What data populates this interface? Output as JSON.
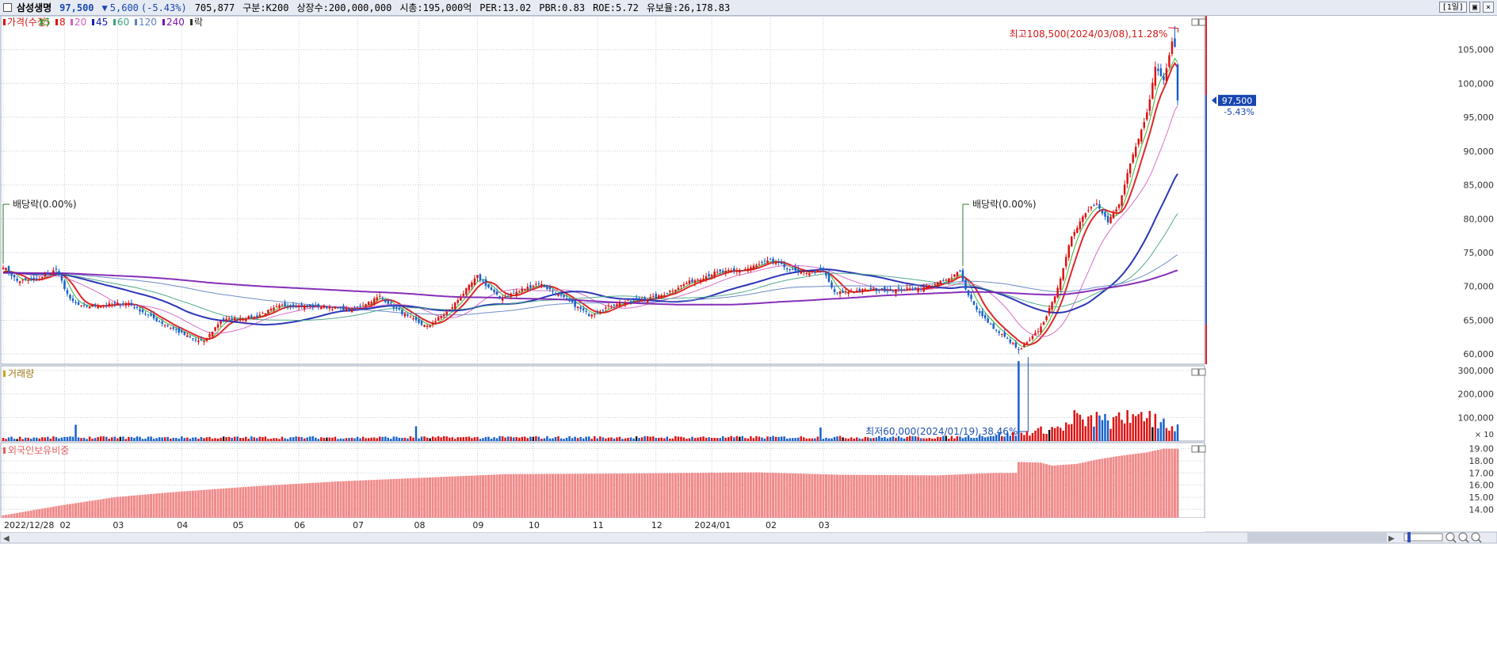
{
  "header": {
    "name": "삼성생명",
    "price": "97,500",
    "change_arrow": "▼",
    "change": "5,600",
    "change_pct": "(-5.43%)",
    "volume": "705,877",
    "market": "구분:K200",
    "shares": "상장수:200,000,000",
    "mktcap": "시총:195,000억",
    "per": "PER:13.02",
    "pbr": "PBR:0.83",
    "roe": "ROE:5.72",
    "float": "유보율:26,178.83",
    "period": "[1일]"
  },
  "legend": {
    "price_label": "가격(수정)",
    "ma": [
      {
        "label": "5",
        "color": "#22aa22"
      },
      {
        "label": "8",
        "color": "#dd1111"
      },
      {
        "label": "20",
        "color": "#d060c0"
      },
      {
        "label": "45",
        "color": "#1520b0"
      },
      {
        "label": "60",
        "color": "#40a080"
      },
      {
        "label": "120",
        "color": "#6080c0"
      },
      {
        "label": "240",
        "color": "#7a18b0"
      }
    ],
    "extra": "락",
    "volume_label": "거래량",
    "foreign_label": "외국인보유비중"
  },
  "annotations": {
    "high": "최고108,500(2024/03/08),11.28%",
    "low": "최저60,000(2024/01/19),38.46%",
    "div1": "배당락(0.00%)",
    "div2": "배당락(0.00%)",
    "current_price": "97,500",
    "current_pct": "-5.43%"
  },
  "colors": {
    "up": "#dd1111",
    "down": "#1560cc",
    "foreign_bar": "#f08a8a",
    "axis_text": "#333333"
  },
  "chart_data": {
    "type": "candlestick",
    "x_labels": [
      "2022/12/28",
      "02",
      "03",
      "04",
      "05",
      "06",
      "07",
      "08",
      "09",
      "10",
      "11",
      "12",
      "2024/01",
      "02",
      "03"
    ],
    "price": {
      "ylim": [
        58500,
        110000
      ],
      "ticks": [
        60000,
        65000,
        70000,
        75000,
        80000,
        85000,
        90000,
        95000,
        100000,
        105000
      ],
      "tick_labels": [
        "60,000",
        "65,000",
        "70,000",
        "75,000",
        "80,000",
        "85,000",
        "90,000",
        "95,000",
        "100,000",
        "105,000"
      ],
      "anchors": [
        [
          0,
          73000
        ],
        [
          5,
          70800
        ],
        [
          12,
          71000
        ],
        [
          19,
          72500
        ],
        [
          24,
          68000
        ],
        [
          28,
          67000
        ],
        [
          45,
          67500
        ],
        [
          55,
          65000
        ],
        [
          68,
          62200
        ],
        [
          72,
          61800
        ],
        [
          78,
          65000
        ],
        [
          90,
          65500
        ],
        [
          100,
          67200
        ],
        [
          115,
          67000
        ],
        [
          125,
          66500
        ],
        [
          135,
          68500
        ],
        [
          145,
          65500
        ],
        [
          152,
          64000
        ],
        [
          160,
          66500
        ],
        [
          170,
          71500
        ],
        [
          178,
          68200
        ],
        [
          192,
          70500
        ],
        [
          202,
          68000
        ],
        [
          210,
          65800
        ],
        [
          220,
          67500
        ],
        [
          235,
          68500
        ],
        [
          245,
          70500
        ],
        [
          255,
          72000
        ],
        [
          265,
          72400
        ],
        [
          275,
          73800
        ],
        [
          285,
          72000
        ],
        [
          294,
          72300
        ],
        [
          298,
          69000
        ],
        [
          310,
          69500
        ],
        [
          322,
          69500
        ],
        [
          330,
          69800
        ],
        [
          335,
          70500
        ],
        [
          340,
          71200
        ],
        [
          343,
          72500
        ],
        [
          345,
          69500
        ],
        [
          350,
          66000
        ],
        [
          356,
          63500
        ],
        [
          362,
          61500
        ],
        [
          364,
          60500
        ],
        [
          368,
          62000
        ],
        [
          372,
          64000
        ],
        [
          376,
          67500
        ],
        [
          380,
          72500
        ],
        [
          383,
          77500
        ],
        [
          388,
          81000
        ],
        [
          392,
          82500
        ],
        [
          396,
          79500
        ],
        [
          400,
          82000
        ],
        [
          404,
          88000
        ],
        [
          408,
          93000
        ],
        [
          411,
          97500
        ],
        [
          413,
          102500
        ],
        [
          416,
          100500
        ],
        [
          419,
          106500
        ],
        [
          420,
          105500
        ],
        [
          421,
          97500
        ]
      ]
    },
    "ma_params": [
      5,
      8,
      20,
      45,
      60,
      120,
      240
    ],
    "ma_pre_history": 72000,
    "div_indices": [
      0,
      344
    ],
    "high_index": 420,
    "low_index": 364,
    "volume": {
      "ylim": [
        0,
        320000
      ],
      "ticks": [
        100000,
        200000,
        300000
      ],
      "tick_labels": [
        "100,000",
        "200,000",
        "300,000"
      ],
      "unit": "× 10",
      "base": 14000,
      "spikes": [
        [
          26,
          55000
        ],
        [
          148,
          48000
        ],
        [
          293,
          42000
        ],
        [
          364,
          310000
        ],
        [
          384,
          60000
        ],
        [
          385,
          45000
        ],
        [
          386,
          35000
        ],
        [
          392,
          38000
        ],
        [
          395,
          32000
        ],
        [
          400,
          44000
        ],
        [
          403,
          50000
        ],
        [
          405,
          30000
        ],
        [
          408,
          36000
        ],
        [
          411,
          42000
        ],
        [
          413,
          38000
        ],
        [
          416,
          30000
        ]
      ],
      "level_anchors": [
        [
          0,
          14000
        ],
        [
          340,
          16000
        ],
        [
          364,
          30000
        ],
        [
          380,
          60000
        ],
        [
          390,
          88000
        ],
        [
          400,
          78000
        ],
        [
          410,
          90000
        ],
        [
          421,
          45000
        ]
      ]
    },
    "foreign": {
      "ylim": [
        13.3,
        19.5
      ],
      "ticks": [
        14,
        15,
        16,
        17,
        18,
        19
      ],
      "tick_labels": [
        "14.00",
        "15.00",
        "16.00",
        "17.00",
        "18.00",
        "19.00"
      ],
      "anchors": [
        [
          0,
          13.5
        ],
        [
          20,
          14.3
        ],
        [
          40,
          15.0
        ],
        [
          60,
          15.4
        ],
        [
          90,
          15.9
        ],
        [
          120,
          16.3
        ],
        [
          150,
          16.6
        ],
        [
          180,
          16.9
        ],
        [
          220,
          16.95
        ],
        [
          270,
          17.05
        ],
        [
          300,
          16.85
        ],
        [
          335,
          16.8
        ],
        [
          355,
          17.0
        ],
        [
          363,
          17.0
        ],
        [
          364,
          17.9
        ],
        [
          372,
          17.85
        ],
        [
          376,
          17.6
        ],
        [
          385,
          17.75
        ],
        [
          392,
          18.1
        ],
        [
          400,
          18.4
        ],
        [
          410,
          18.7
        ],
        [
          416,
          19.0
        ],
        [
          421,
          19.0
        ]
      ]
    }
  }
}
